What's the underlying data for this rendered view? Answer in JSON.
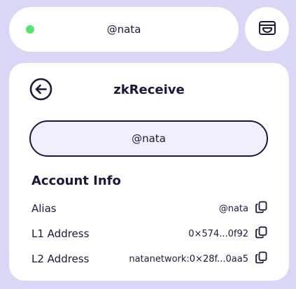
{
  "header": {
    "status_color": "#58e36b",
    "status": "online",
    "handle": "@nata",
    "wallet_icon": "wallet-icon"
  },
  "card": {
    "back_icon": "arrow-left-circle-icon",
    "title": "zkReceive",
    "handle_value": "@nata",
    "section_title": "Account Info",
    "rows": [
      {
        "label": "Alias",
        "value": "@nata",
        "icon": "copy-icon"
      },
      {
        "label": "L1 Address",
        "value": "0×574...0f92",
        "icon": "copy-icon"
      },
      {
        "label": "L2 Address",
        "value": "natanetwork:0×28f...0aa5",
        "icon": "copy-icon"
      }
    ]
  },
  "colors": {
    "background": "#d9d6f6",
    "surface": "#ffffff",
    "accent_text": "#1c1838",
    "pill_fill": "#f1effd"
  }
}
